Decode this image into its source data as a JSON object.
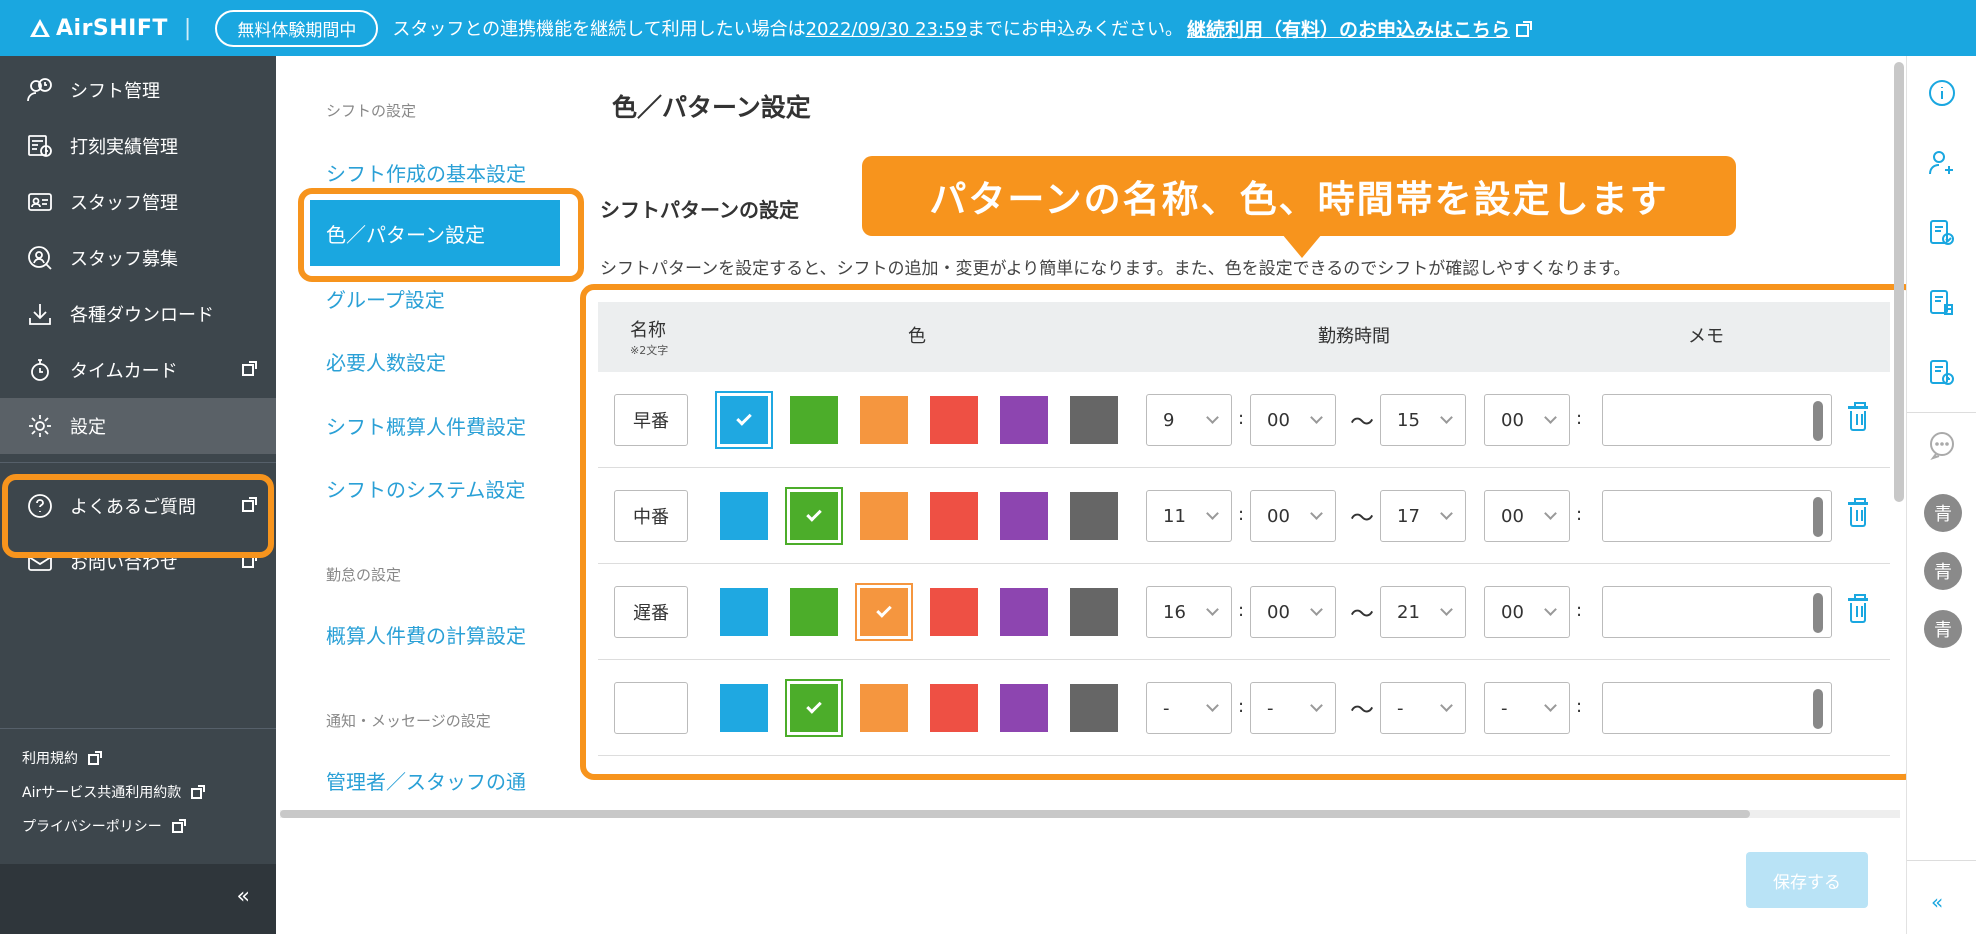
{
  "banner": {
    "logo": "AirSHIFT",
    "separator": "|",
    "trial_badge": "無料体験期間中",
    "notice_before": "スタッフとの連携機能を継続して利用したい場合は",
    "notice_date": "2022/09/30 23:59",
    "notice_after": "までにお申込みください。",
    "link": "継続利用（有料）のお申込みはこちら"
  },
  "sidebar": {
    "items": [
      {
        "label": "シフト管理",
        "icon": "user-clock-icon"
      },
      {
        "label": "打刻実績管理",
        "icon": "timesheet-icon"
      },
      {
        "label": "スタッフ管理",
        "icon": "staff-card-icon"
      },
      {
        "label": "スタッフ募集",
        "icon": "user-search-icon"
      },
      {
        "label": "各種ダウンロード",
        "icon": "download-icon"
      },
      {
        "label": "タイムカード",
        "icon": "stopwatch-icon"
      },
      {
        "label": "設定",
        "icon": "gear-icon"
      },
      {
        "label": "よくあるご質問",
        "icon": "question-icon"
      },
      {
        "label": "お問い合わせ",
        "icon": "mail-icon"
      }
    ],
    "footer_links": [
      "利用規約",
      "Airサービス共通利用約款",
      "プライバシーポリシー"
    ],
    "collapse": "«"
  },
  "subnav": {
    "section1": "シフトの設定",
    "links1": [
      "シフト作成の基本設定",
      "色／パターン設定",
      "グループ設定",
      "必要人数設定",
      "シフト概算人件費設定",
      "シフトのシステム設定"
    ],
    "section2": "勤怠の設定",
    "links2": [
      "概算人件費の計算設定"
    ],
    "section3": "通知・メッセージの設定",
    "links3": [
      "管理者／スタッフの通"
    ]
  },
  "main": {
    "title": "色／パターン設定",
    "section_title": "シフトパターンの設定",
    "description": "シフトパターンを設定すると、シフトの追加・変更がより簡単になります。また、色を設定できるのでシフトが確認しやすくなります。",
    "callout": "パターンの名称、色、時間帯を設定します",
    "save": "保存する"
  },
  "table": {
    "headers": {
      "name": "名称",
      "name_note": "※2文字",
      "color": "色",
      "time": "勤務時間",
      "memo": "メモ"
    },
    "palette": [
      "#1fa8e1",
      "#4cad2a",
      "#f5963f",
      "#ee5044",
      "#8d45b0",
      "#666666"
    ],
    "separator_colon": ":",
    "separator_tilde": "〜",
    "rows": [
      {
        "name": "早番",
        "selected": 0,
        "start_h": "9",
        "start_m": "00",
        "end_h": "15",
        "end_m": "00",
        "memo": ""
      },
      {
        "name": "中番",
        "selected": 1,
        "start_h": "11",
        "start_m": "00",
        "end_h": "17",
        "end_m": "00",
        "memo": ""
      },
      {
        "name": "遅番",
        "selected": 2,
        "start_h": "16",
        "start_m": "00",
        "end_h": "21",
        "end_m": "00",
        "memo": ""
      },
      {
        "name": "",
        "selected": 1,
        "start_h": "-",
        "start_m": "-",
        "end_h": "-",
        "end_m": "-",
        "memo": ""
      }
    ]
  },
  "rail": {
    "icons": [
      "info-icon",
      "add-user-icon",
      "document-check-icon",
      "document-clock-icon",
      "document-lock-icon",
      "chat-icon"
    ],
    "avatars": [
      "青",
      "青",
      "青"
    ],
    "collapse": "«"
  }
}
